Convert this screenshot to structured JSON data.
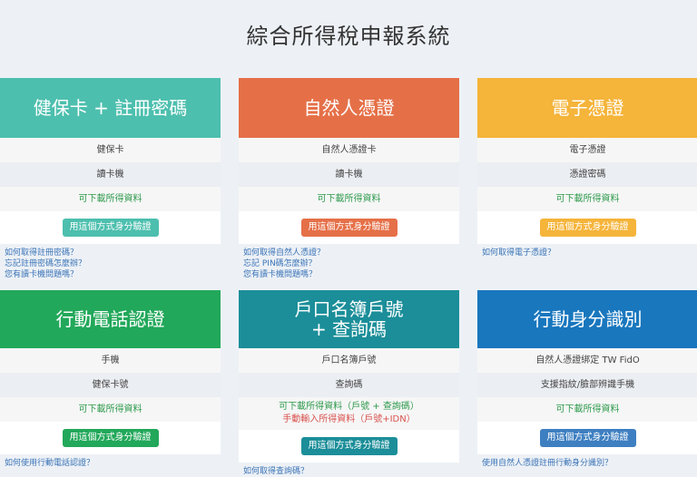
{
  "page": {
    "title": "綜合所得稅申報系統"
  },
  "colors": {
    "teal": "#4dbfae",
    "orange": "#e57048",
    "yellow": "#f5b43a",
    "green": "#22a85a",
    "darkteal": "#1b8e99",
    "blue": "#1977be",
    "btnblue": "#3e7fc1"
  },
  "cards": [
    {
      "title": "健保卡 + 註冊密碼",
      "rows": [
        "健保卡",
        "讀卡機"
      ],
      "status": "可下載所得資料",
      "button": "用這個方式身分驗證",
      "links": [
        "如何取得註冊密碼？",
        "忘記註冊密碼怎麼辦？",
        "您有讀卡機問題嗎？"
      ]
    },
    {
      "title": "自然人憑證",
      "rows": [
        "自然人憑證卡",
        "讀卡機"
      ],
      "status": "可下載所得資料",
      "button": "用這個方式身分驗證",
      "links": [
        "如何取得自然人憑證？",
        "忘記 PIN碼怎麼辦？",
        "您有讀卡機問題嗎？"
      ]
    },
    {
      "title": "電子憑證",
      "rows": [
        "電子憑證",
        "憑證密碼"
      ],
      "status": "可下載所得資料",
      "button": "用這個方式身分驗證",
      "links": [
        "如何取得電子憑證？"
      ]
    },
    {
      "title": "行動電話認證",
      "rows": [
        "手機",
        "健保卡號"
      ],
      "status": "可下載所得資料",
      "button": "用這個方式身分驗證",
      "links": [
        "如何使用行動電話認證？"
      ]
    },
    {
      "title_line1": "戶口名簿戶號",
      "title_line2": "+ 查詢碼",
      "rows": [
        "戶口名簿戶號",
        "查詢碼"
      ],
      "status": "可下載所得資料（戶號 + 查詢碼）",
      "status2": "手動輸入所得資料（戶號+IDN）",
      "button": "用這個方式身分驗證",
      "links": [
        "如何取得查詢碼？"
      ]
    },
    {
      "title": "行動身分識別",
      "rows": [
        "自然人憑證綁定 TW FidO",
        "支援指紋/臉部辨識手機"
      ],
      "status": "可下載所得資料",
      "button": "用這個方式身分驗證",
      "links": [
        "使用自然人憑證註冊行動身分識別？"
      ]
    }
  ]
}
